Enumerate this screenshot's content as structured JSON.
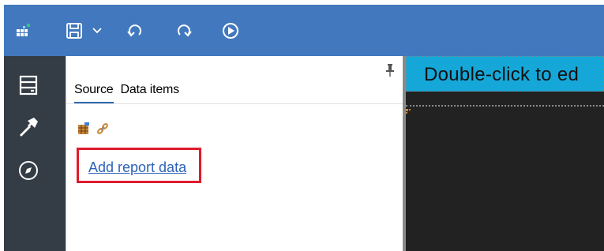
{
  "toolbar": {
    "icons": [
      "app-logo-icon",
      "save-icon",
      "chevron-down-icon",
      "undo-icon",
      "redo-icon",
      "run-icon"
    ],
    "colors": {
      "background": "#4178be",
      "logo_accent": "#2ecc71"
    }
  },
  "leftnav": {
    "icons": [
      "data-panel-icon",
      "toolbox-hammer-icon",
      "navigate-compass-icon"
    ],
    "colors": {
      "background": "#343c45"
    }
  },
  "panel": {
    "tabs": [
      {
        "label": "Source",
        "active": true
      },
      {
        "label": "Data items",
        "active": false
      }
    ],
    "source_icons": [
      "table-icon",
      "link-icon"
    ],
    "add_link_label": "Add report data",
    "colors": {
      "link": "#2d62b8",
      "highlight_box": "#e01b2c",
      "tab_underline": "#2f69b0"
    }
  },
  "canvas": {
    "title_placeholder": "Double-click to ed",
    "colors": {
      "title_bar": "#15a7d8",
      "background": "#222222"
    }
  }
}
